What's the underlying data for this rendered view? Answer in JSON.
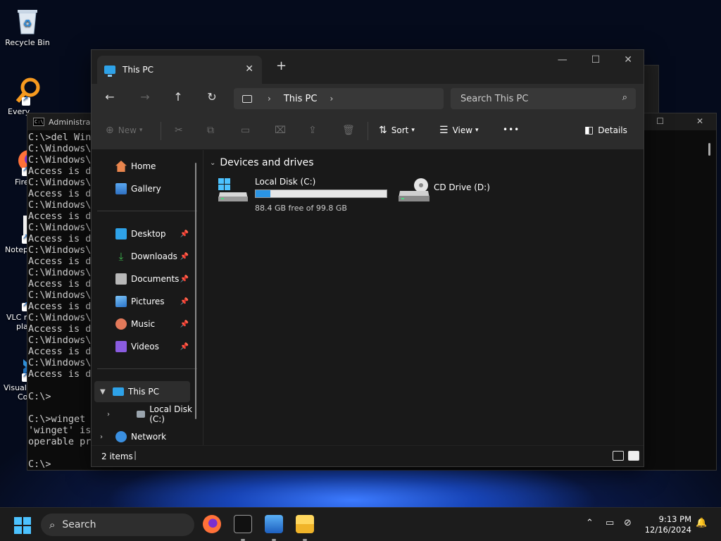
{
  "desktop": {
    "icons": [
      {
        "label": "Recycle Bin",
        "icon": "recycle-bin-icon"
      },
      {
        "label": "Every",
        "icon": "everything-search-icon"
      },
      {
        "label": "Fire",
        "icon": "firefox-icon"
      },
      {
        "label": "Notep",
        "icon": "notepad-plus-plus-icon"
      },
      {
        "label": "VLC m",
        "label2": "pla",
        "icon": "vlc-icon"
      },
      {
        "label": "Visual",
        "label2": "Co",
        "icon": "vscode-icon"
      }
    ]
  },
  "cmd": {
    "title": "Administra",
    "lines": [
      "C:\\>del Wind",
      "C:\\Windows\\",
      "C:\\Windows\\",
      "Access is de",
      "C:\\Windows\\",
      "Access is de",
      "C:\\Windows\\",
      "Access is de",
      "C:\\Windows\\",
      "Access is de",
      "C:\\Windows\\",
      "Access is de",
      "C:\\Windows\\",
      "Access is de",
      "C:\\Windows\\",
      "Access is de",
      "C:\\Windows\\",
      "Access is de",
      "C:\\Windows\\",
      "Access is de",
      "C:\\Windows\\",
      "Access is de",
      "",
      "C:\\>",
      "",
      "C:\\>winget s",
      "'winget' is",
      "operable pro",
      "",
      "C:\\>"
    ]
  },
  "explorer": {
    "tab_title": "This PC",
    "address": {
      "segments": [
        "This PC"
      ]
    },
    "search_placeholder": "Search This PC",
    "commands": {
      "new": "New",
      "sort": "Sort",
      "view": "View",
      "more": "•••",
      "details": "Details"
    },
    "sidebar": {
      "top": [
        {
          "label": "Home",
          "icon": "home-icon"
        },
        {
          "label": "Gallery",
          "icon": "gallery-icon"
        }
      ],
      "quick_access": [
        {
          "label": "Desktop",
          "icon": "desktop-folder-icon",
          "color": "#2ea2e8"
        },
        {
          "label": "Downloads",
          "icon": "downloads-icon",
          "color": "#3fb950"
        },
        {
          "label": "Documents",
          "icon": "documents-icon",
          "color": "#b8b8b8"
        },
        {
          "label": "Pictures",
          "icon": "pictures-icon",
          "color": "#3a8fe0"
        },
        {
          "label": "Music",
          "icon": "music-icon",
          "color": "#e2795a"
        },
        {
          "label": "Videos",
          "icon": "videos-icon",
          "color": "#8a5ce0"
        }
      ],
      "this_pc": "This PC",
      "local_disk": "Local Disk (C:)",
      "network": "Network"
    },
    "content": {
      "group_title": "Devices and drives",
      "drives": [
        {
          "name": "Local Disk (C:)",
          "free_text": "88.4 GB free of 99.8 GB",
          "used_fraction": 0.114
        },
        {
          "name": "CD Drive (D:)"
        }
      ]
    },
    "status": {
      "item_count": "2 items",
      "cursor": "|"
    }
  },
  "taskbar": {
    "search_label": "Search",
    "time": "9:13 PM",
    "date": "12/16/2024",
    "apps": [
      "firefox-icon",
      "terminal-icon",
      "photos-icon",
      "file-explorer-icon"
    ]
  },
  "colors": {
    "accent": "#4cc2ff",
    "progress": "#2a94e4",
    "explorer_bg": "#191919"
  }
}
